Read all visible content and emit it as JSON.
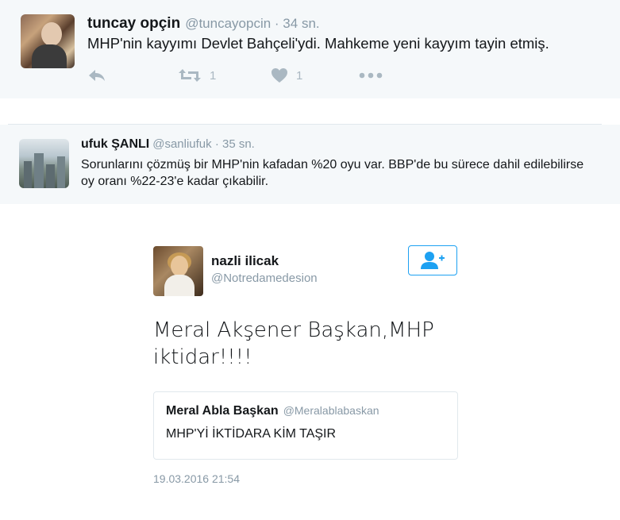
{
  "tweets": [
    {
      "name": "tuncay opçin",
      "handle": "@tuncayopcin",
      "time": "· 34 sn.",
      "text": "MHP'nin kayyımı Devlet Bahçeli'ydi. Mahkeme yeni kayyım tayin etmiş.",
      "retweet_count": "1",
      "like_count": "1"
    },
    {
      "name": "ufuk ŞANLI",
      "handle": "@sanliufuk",
      "time": "· 35 sn.",
      "text": "Sorunlarını çözmüş bir MHP'nin kafadan %20 oyu var. BBP'de bu sürece dahil edilebilirse oy oranı %22-23'e kadar çıkabilir."
    }
  ],
  "embedded": {
    "name": "nazli ilicak",
    "handle": "@Notredamedesion",
    "text": "Meral Akşener Başkan,MHP iktidar!!!!",
    "quote": {
      "name": "Meral Abla Başkan",
      "handle": "@Meralablabaskan",
      "text": "MHP'Yİ İKTİDARA KİM TAŞIR"
    },
    "timestamp": "19.03.2016 21:54"
  },
  "icons": {
    "reply": "reply-icon",
    "retweet": "retweet-icon",
    "like": "heart-icon",
    "more": "more-icon",
    "follow": "follow-user-icon"
  },
  "colors": {
    "accent": "#1da1f2",
    "muted": "#8899a6",
    "action": "#aab8c2"
  }
}
